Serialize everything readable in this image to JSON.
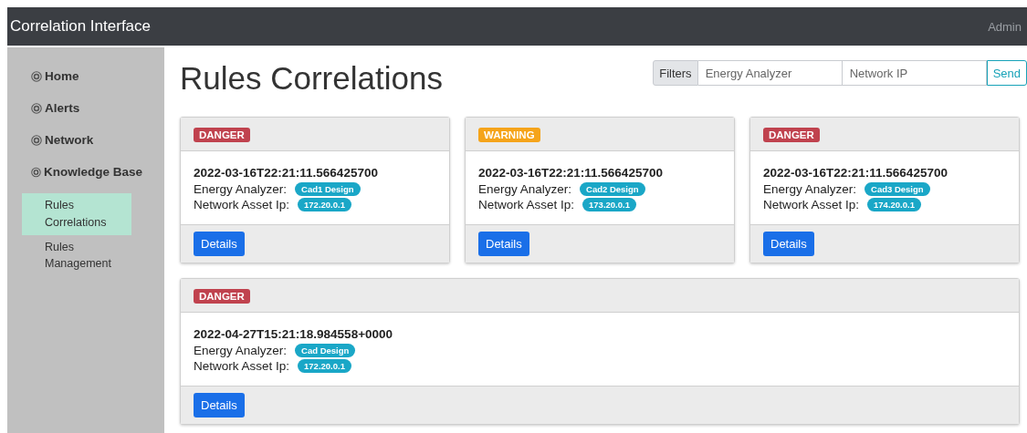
{
  "navbar": {
    "brand": "Correlation Interface",
    "user": "Admin"
  },
  "sidebar": {
    "items": [
      {
        "label": "Home",
        "selected": false
      },
      {
        "label": "Alerts",
        "selected": false
      },
      {
        "label": "Network",
        "selected": false
      },
      {
        "label": "Knowledge Base",
        "selected": false,
        "children": [
          {
            "label": "Rules Correlations",
            "selected": true
          },
          {
            "label": "Rules Management",
            "selected": false
          }
        ]
      }
    ]
  },
  "page_title": "Rules Correlations",
  "filters": {
    "label": "Filters",
    "fields": [
      {
        "placeholder": "Energy Analyzer"
      },
      {
        "placeholder": "Network IP"
      }
    ],
    "button": "Send"
  },
  "cards": [
    {
      "badge": "DANGER",
      "kind": "danger",
      "timestamp": "2022-03-16T22:21:11.566425700",
      "energy_label": "Energy Analyzer:",
      "energy": "Cad1 Design",
      "ip_label": "Network Asset Ip:",
      "ip": "172.20.0.1",
      "button": "Details",
      "wide": false
    },
    {
      "badge": "WARNING",
      "kind": "warning",
      "timestamp": "2022-03-16T22:21:11.566425700",
      "energy_label": "Energy Analyzer:",
      "energy": "Cad2 Design",
      "ip_label": "Network Asset Ip:",
      "ip": "173.20.0.1",
      "button": "Details",
      "wide": false
    },
    {
      "badge": "DANGER",
      "kind": "danger",
      "timestamp": "2022-03-16T22:21:11.566425700",
      "energy_label": "Energy Analyzer:",
      "energy": "Cad3 Design",
      "ip_label": "Network Asset Ip:",
      "ip": "174.20.0.1",
      "button": "Details",
      "wide": false
    },
    {
      "badge": "DANGER",
      "kind": "danger",
      "timestamp": "2022-04-27T15:21:18.984558+0000",
      "energy_label": "Energy Analyzer:",
      "energy": "Cad Design",
      "ip_label": "Network Asset Ip:",
      "ip": "172.20.0.1",
      "button": "Details",
      "wide": true
    }
  ]
}
